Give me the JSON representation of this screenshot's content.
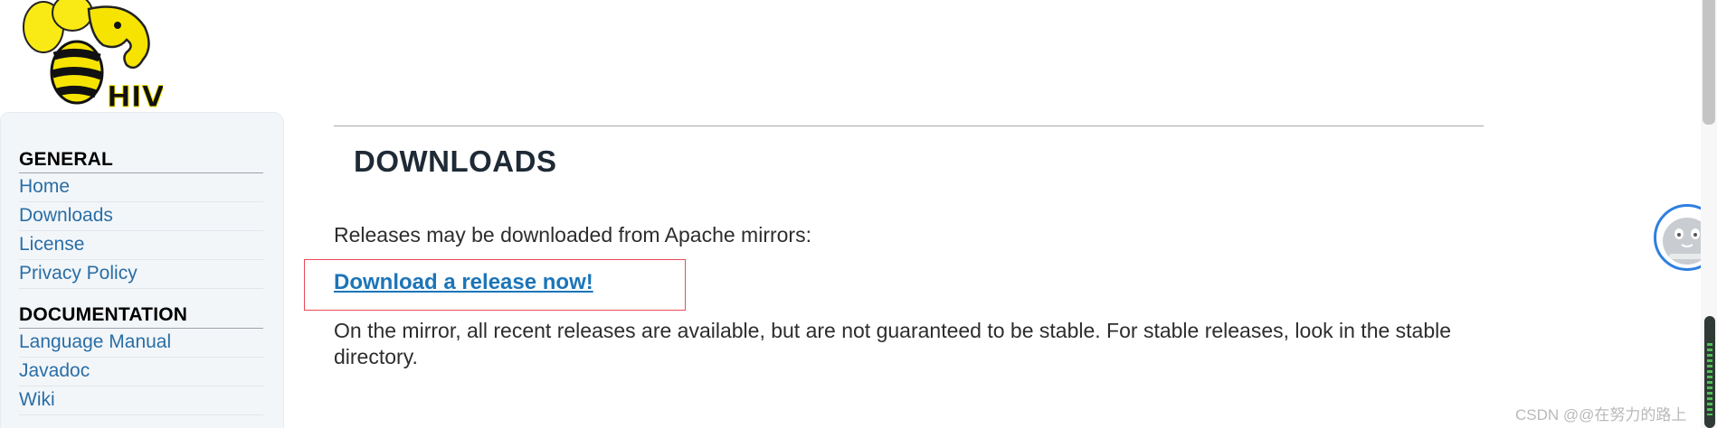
{
  "logo": {
    "text": "HIVE"
  },
  "sidebar": {
    "sections": [
      {
        "heading": "GENERAL",
        "items": [
          "Home",
          "Downloads",
          "License",
          "Privacy Policy"
        ]
      },
      {
        "heading": "DOCUMENTATION",
        "items": [
          "Language Manual",
          "Javadoc",
          "Wiki"
        ]
      }
    ]
  },
  "main": {
    "title": "DOWNLOADS",
    "intro": "Releases may be downloaded from Apache mirrors:",
    "download_link": "Download a release now!",
    "note": "On the mirror, all recent releases are available, but are not guaranteed to be stable. For stable releases, look in the stable directory."
  },
  "watermark": "CSDN @@在努力的路上",
  "colors": {
    "link": "#1c75b8",
    "highlight": "#ec4b55",
    "sidebar_bg": "#f3f6f9"
  }
}
